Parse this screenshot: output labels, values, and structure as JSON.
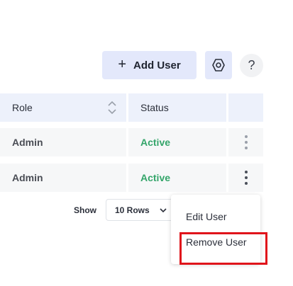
{
  "toolbar": {
    "add_user_label": "Add User",
    "add_icon": "plus-icon",
    "settings_icon": "hexagon-settings-icon",
    "help_label": "?"
  },
  "table": {
    "columns": [
      {
        "label": "Role",
        "sortable": true
      },
      {
        "label": "Status",
        "sortable": false
      },
      {
        "label": "",
        "sortable": false
      }
    ],
    "rows": [
      {
        "role": "Admin",
        "status": "Active"
      },
      {
        "role": "Admin",
        "status": "Active"
      }
    ]
  },
  "footer": {
    "show_label": "Show",
    "rows_per_page": "10 Rows"
  },
  "row_menu": {
    "items": [
      {
        "label": "Edit User"
      },
      {
        "label": "Remove User"
      }
    ]
  },
  "colors": {
    "accent_bg": "#e3e8fb",
    "status_active": "#34a56a",
    "highlight": "#e0141b"
  }
}
